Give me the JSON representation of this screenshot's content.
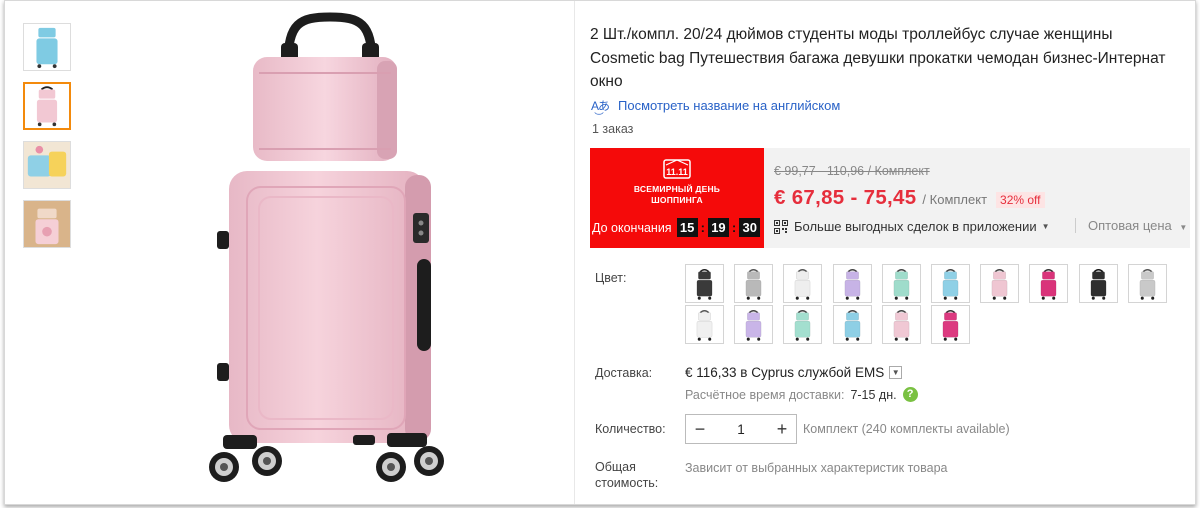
{
  "product": {
    "title": "2 Шт./компл. 20/24 дюймов студенты моды троллейбус случае женщины Cosmetic bag Путешествия багажа девушки прокатки чемодан бизнес-Интернат окно",
    "translate_link": "Посмотреть название на английском",
    "orders": "1 заказ"
  },
  "promo": {
    "badge_logo": "11.11",
    "badge_line1": "ВСЕМИРНЫЙ ДЕНЬ",
    "badge_line2": "ШОППИНГА",
    "countdown_label": "До окончания",
    "hours": "15",
    "minutes": "19",
    "seconds": "30"
  },
  "price": {
    "old": "€ 99,77 - 110,96 / Комплект",
    "current": "€ 67,85 - 75,45",
    "unit": "/ Комплект",
    "discount": "32% off",
    "app_deals": "Больше выгодных сделок в приложении",
    "wholesale": "Оптовая цена"
  },
  "color": {
    "label": "Цвет:",
    "swatches": [
      {
        "name": "black",
        "body": "#3a3a3a",
        "handle": "#222222"
      },
      {
        "name": "gray",
        "body": "#b9b9b9",
        "handle": "#555555"
      },
      {
        "name": "white",
        "body": "#eeeeee",
        "handle": "#555555"
      },
      {
        "name": "purple",
        "body": "#c7b3e6",
        "handle": "#444444"
      },
      {
        "name": "mint",
        "body": "#9fdccb",
        "handle": "#444444"
      },
      {
        "name": "blue",
        "body": "#8fd0e6",
        "handle": "#444444"
      },
      {
        "name": "pink",
        "body": "#efc6d2",
        "handle": "#444444"
      },
      {
        "name": "rose",
        "body": "#d9347a",
        "handle": "#333333"
      },
      {
        "name": "black-2",
        "body": "#2f2f2f",
        "handle": "#111111"
      },
      {
        "name": "silver",
        "body": "#c9c9c9",
        "handle": "#555555"
      },
      {
        "name": "white-2",
        "body": "#f0f0f0",
        "handle": "#555555"
      },
      {
        "name": "purple-2",
        "body": "#c9b5e8",
        "handle": "#444444"
      },
      {
        "name": "mint-2",
        "body": "#a3dfcf",
        "handle": "#444444"
      },
      {
        "name": "blue-2",
        "body": "#8ecfe5",
        "handle": "#444444"
      },
      {
        "name": "pink-2",
        "body": "#f0c8d4",
        "handle": "#444444"
      },
      {
        "name": "rose-2",
        "body": "#dc3a80",
        "handle": "#333333"
      }
    ]
  },
  "shipping": {
    "label": "Доставка:",
    "price": "€ 116,33 в Cyprus службой EMS",
    "time_label": "Расчётное время доставки:",
    "time_value": "7-15 дн.",
    "help": "?"
  },
  "quantity": {
    "label": "Количество:",
    "value": "1",
    "minus": "−",
    "plus": "+",
    "note": "Комплект (240 комплекты available)"
  },
  "total": {
    "label": "Общая стоимость:",
    "note": "Зависит от выбранных характеристик товара"
  },
  "colors": {
    "accent_red": "#e62e3c",
    "promo_red": "#f50a0a",
    "link_blue": "#2962c7",
    "active_thumb": "#f38a0c",
    "suitcase_pink": "#f2c8d3"
  }
}
